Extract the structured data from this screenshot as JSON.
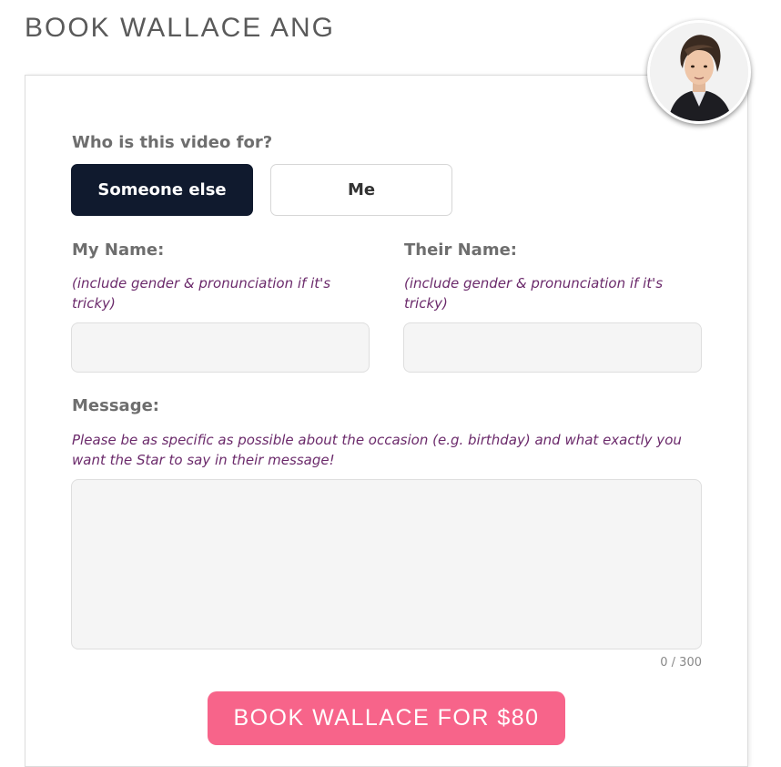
{
  "header": {
    "title": "BOOK WALLACE ANG"
  },
  "avatar": {
    "icon": "person-photo-avatar"
  },
  "recipient": {
    "question": "Who is this video for?",
    "options": [
      "Someone else",
      "Me"
    ],
    "selected": "Someone else"
  },
  "form": {
    "my_name": {
      "label": "My Name:",
      "hint": "(include gender & pronunciation if it's tricky)",
      "value": ""
    },
    "their_name": {
      "label": "Their Name:",
      "hint": "(include gender & pronunciation if it's tricky)",
      "value": ""
    },
    "message": {
      "label": "Message:",
      "hint": "Please be as specific as possible about the occasion (e.g. birthday) and what exactly you want the Star to say in their message!",
      "value": "",
      "counter": "0 / 300"
    }
  },
  "cta": {
    "label": "BOOK WALLACE FOR $80"
  },
  "colors": {
    "selected_button": "#101a2e",
    "accent": "#f7648a",
    "hint_text": "#6b2a6b"
  }
}
